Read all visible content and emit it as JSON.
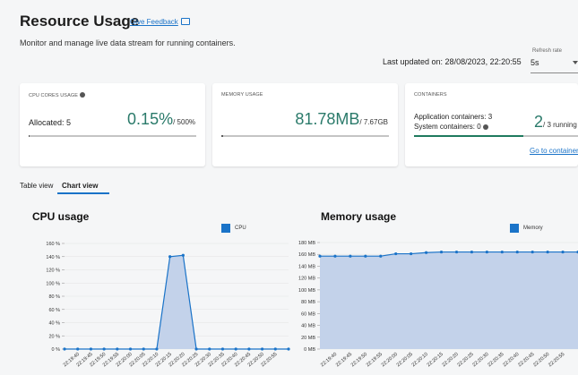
{
  "header": {
    "title": "Resource Usage",
    "feedback_label": "Give Feedback",
    "subtitle": "Monitor and manage live data stream for running containers.",
    "last_updated": "Last updated on: 28/08/2023, 22:20:55",
    "refresh_label": "Refresh rate",
    "refresh_value": "5s"
  },
  "cards": {
    "cpu": {
      "label": "CPU CORES USAGE",
      "allocated": "Allocated: 5",
      "value": "0.15%",
      "suffix": "/ 500%",
      "progress": 0.0003
    },
    "memory": {
      "label": "MEMORY USAGE",
      "value": "81.78MB",
      "suffix": "/ 7.67GB",
      "progress": 0.0104
    },
    "containers": {
      "label": "CONTAINERS",
      "app": "Application containers: 3",
      "system": "System containers: 0",
      "value": "2",
      "suffix": "/ 3 running",
      "link": "Go to containers",
      "progress": 0.667
    }
  },
  "tabs": [
    {
      "label": "Table view",
      "active": false
    },
    {
      "label": "Chart view",
      "active": true
    }
  ],
  "colors": {
    "accent": "#1a73c8",
    "teal": "#2a7a6a",
    "area": "#c3d2ea"
  },
  "chart_data": [
    {
      "type": "area",
      "title": "CPU usage",
      "series": [
        {
          "name": "CPU",
          "values": [
            0,
            0,
            0,
            0,
            0,
            0,
            0,
            0,
            140,
            142,
            0,
            0,
            0,
            0,
            0,
            0,
            0,
            0
          ]
        }
      ],
      "x": [
        "22:19:40",
        "22:19:45",
        "22:19:50",
        "22:19:55",
        "22:20:00",
        "22:20:05",
        "22:20:10",
        "22:20:15",
        "22:20:20",
        "22:20:25",
        "22:20:30",
        "22:20:35",
        "22:20:40",
        "22:20:45",
        "22:20:50",
        "22:20:55"
      ],
      "y_ticks": [
        "0 %",
        "20 %",
        "40 %",
        "60 %",
        "80 %",
        "100 %",
        "120 %",
        "140 %",
        "160 %"
      ],
      "ylim": [
        0,
        160
      ]
    },
    {
      "type": "area",
      "title": "Memory usage",
      "series": [
        {
          "name": "Memory",
          "values": [
            157,
            157,
            157,
            157,
            157,
            161,
            161,
            163,
            164,
            164,
            164,
            164,
            164,
            164,
            164,
            164,
            164,
            164
          ]
        }
      ],
      "x": [
        "22:19:40",
        "22:19:45",
        "22:19:50",
        "22:19:55",
        "22:20:00",
        "22:20:05",
        "22:20:10",
        "22:20:15",
        "22:20:20",
        "22:20:25",
        "22:20:30",
        "22:20:35",
        "22:20:40",
        "22:20:45",
        "22:20:50",
        "22:20:55"
      ],
      "y_ticks": [
        "0 MB",
        "20 MB",
        "40 MB",
        "60 MB",
        "80 MB",
        "100 MB",
        "120 MB",
        "140 MB",
        "160 MB",
        "180 MB"
      ],
      "ylim": [
        0,
        180
      ]
    }
  ]
}
